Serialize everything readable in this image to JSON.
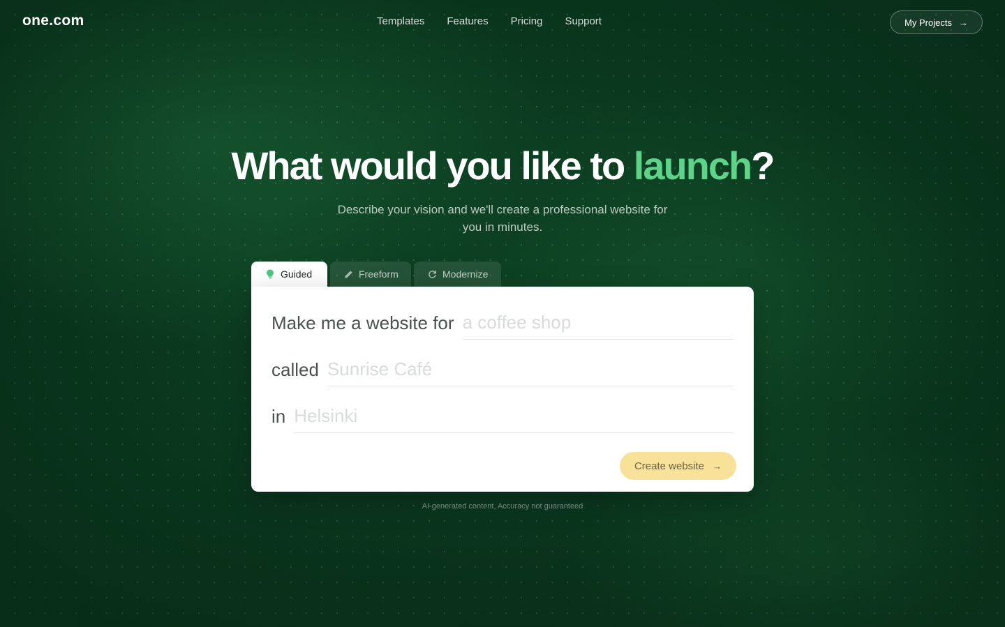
{
  "header": {
    "logo": "one.com",
    "nav": [
      "Templates",
      "Features",
      "Pricing",
      "Support"
    ],
    "projects_button": "My Projects",
    "arrow": "→"
  },
  "hero": {
    "title_prefix": "What would you like to ",
    "title_accent": "launch",
    "title_suffix": "?",
    "subtitle": "Describe your vision and we'll create a professional website for you in minutes."
  },
  "tabs": [
    {
      "label": "Guided",
      "icon": "lightbulb-icon",
      "active": true
    },
    {
      "label": "Freeform",
      "icon": "pencil-icon",
      "active": false
    },
    {
      "label": "Modernize",
      "icon": "refresh-icon",
      "active": false
    }
  ],
  "form": {
    "row1_label": "Make me a website for",
    "row1_placeholder": "a coffee shop",
    "row2_label": "called",
    "row2_placeholder": "Sunrise Café",
    "row3_label": "in",
    "row3_placeholder": "Helsinki",
    "submit_label": "Create website",
    "arrow": "→"
  },
  "disclaimer": "AI-generated content, Accuracy not guaranteed",
  "colors": {
    "background": "#0b3b20",
    "accent_green": "#5fd38a",
    "button_yellow": "#f8e29a",
    "card": "#ffffff"
  }
}
